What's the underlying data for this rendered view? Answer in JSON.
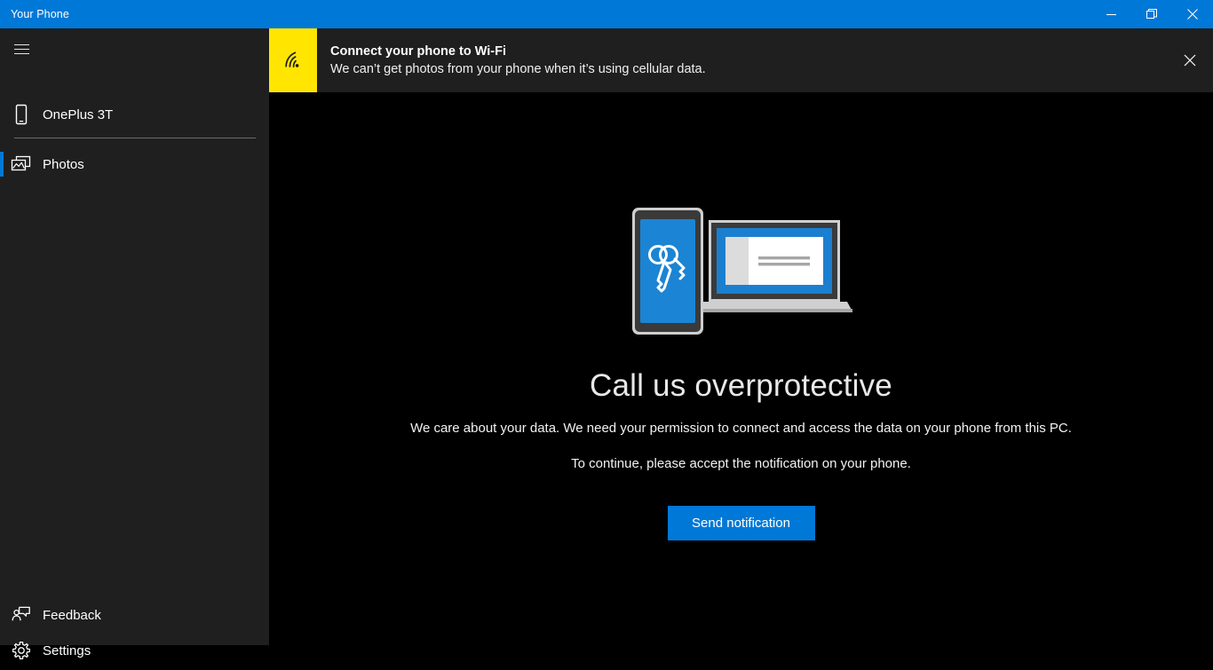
{
  "window": {
    "title": "Your Phone",
    "titlebar_color": "#0078d7",
    "controls": [
      {
        "name": "minimize",
        "label": "Minimize"
      },
      {
        "name": "restore",
        "label": "Restore"
      },
      {
        "name": "close",
        "label": "Close"
      }
    ]
  },
  "sidebar": {
    "background": "#1f1f1f",
    "accent_color": "#0078d7",
    "menu_button": {
      "icon": "hamburger-menu-icon",
      "label": "Menu"
    },
    "items": [
      {
        "label": "OnePlus 3T",
        "icon": "phone-icon",
        "selected": false
      },
      {
        "label": "Photos",
        "icon": "photos-icon",
        "selected": true
      }
    ],
    "footer_items": [
      {
        "label": "Feedback",
        "icon": "feedback-icon"
      },
      {
        "label": "Settings",
        "icon": "gear-icon"
      }
    ]
  },
  "banner": {
    "icon": "wifi-icon",
    "badge_color": "#ffe500",
    "title": "Connect your phone to Wi-Fi",
    "description": "We can’t get photos from your phone when it’s using cellular data.",
    "close_icon": "close-icon"
  },
  "main": {
    "illustration": "phone-and-laptop-with-keys-icon",
    "heading": "Call us overprotective",
    "paragraph_1": "We care about your data. We need your permission to connect and access the data on your phone from this PC.",
    "paragraph_2": "To continue, please accept the notification on your phone.",
    "primary_button": "Send notification",
    "primary_button_color": "#0078d7",
    "background": "#000000"
  }
}
